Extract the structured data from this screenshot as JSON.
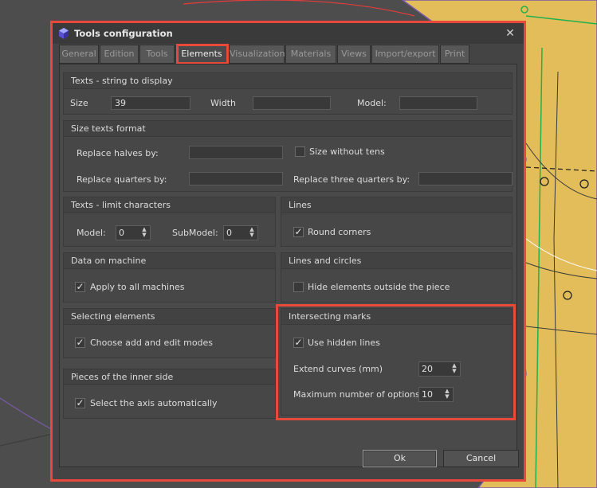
{
  "window": {
    "title": "Tools configuration",
    "close_glyph": "✕"
  },
  "tabs": [
    {
      "label": "General"
    },
    {
      "label": "Edition"
    },
    {
      "label": "Tools"
    },
    {
      "label": "Elements"
    },
    {
      "label": "Visualization"
    },
    {
      "label": "Materials"
    },
    {
      "label": "Views"
    },
    {
      "label": "Import/export"
    },
    {
      "label": "Print"
    }
  ],
  "active_tab": "Elements",
  "texts_display": {
    "title": "Texts - string to display",
    "size_label": "Size",
    "size_value": "39",
    "width_label": "Width",
    "width_value": "",
    "model_label": "Model:",
    "model_value": ""
  },
  "size_format": {
    "title": "Size texts format",
    "halves_label": "Replace halves by:",
    "halves_value": "",
    "quarters_label": "Replace quarters by:",
    "quarters_value": "",
    "without_tens_label": "Size without tens",
    "without_tens_checked": false,
    "three_quarters_label": "Replace three quarters by:",
    "three_quarters_value": ""
  },
  "limit_chars": {
    "title": "Texts - limit characters",
    "model_label": "Model:",
    "model_value": "0",
    "submodel_label": "SubModel:",
    "submodel_value": "0"
  },
  "lines": {
    "title": "Lines",
    "round_corners_label": "Round corners",
    "round_corners_checked": true
  },
  "data_machine": {
    "title": "Data on machine",
    "apply_all_label": "Apply to all machines",
    "apply_all_checked": true
  },
  "lines_circles": {
    "title": "Lines and circles",
    "hide_outside_label": "Hide elements outside the piece",
    "hide_outside_checked": false
  },
  "selecting": {
    "title": "Selecting elements",
    "choose_modes_label": "Choose add and edit modes",
    "choose_modes_checked": true
  },
  "intersecting": {
    "title": "Intersecting marks",
    "hidden_lines_label": "Use hidden lines",
    "hidden_lines_checked": true,
    "extend_label": "Extend curves (mm)",
    "extend_value": "20",
    "max_options_label": "Maximum number of options:",
    "max_options_value": "10"
  },
  "inner_side": {
    "title": "Pieces of the inner side",
    "select_axis_label": "Select the axis automatically",
    "select_axis_checked": true
  },
  "buttons": {
    "ok": "Ok",
    "cancel": "Cancel"
  },
  "icons": {
    "app": "app-logo-icon",
    "close": "close-icon",
    "spin_up": "▲",
    "spin_down": "▼",
    "check": "✓"
  },
  "colors": {
    "highlight": "#e8493b",
    "piece_fill": "#e3be5c",
    "piece_outline": "#7f5fb0",
    "cad_green": "#22b14c"
  }
}
